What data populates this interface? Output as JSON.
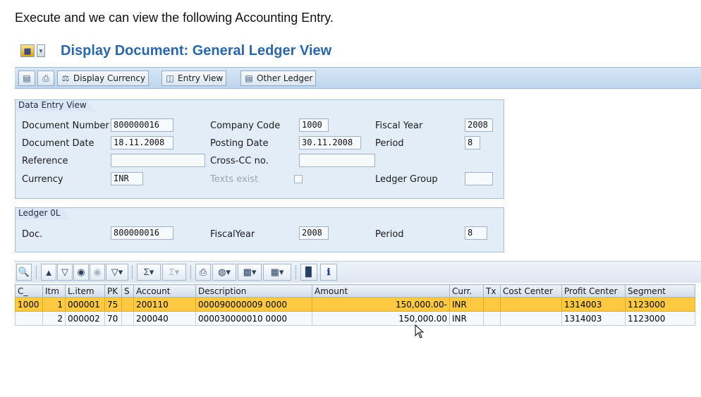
{
  "intro_text": "Execute and we can view the following Accounting Entry.",
  "window": {
    "title": "Display Document: General Ledger View"
  },
  "toolbar": {
    "display_currency": "Display Currency",
    "entry_view": "Entry View",
    "other_ledger": "Other Ledger"
  },
  "data_entry_view": {
    "group_title": "Data Entry View",
    "document_number_label": "Document Number",
    "document_number": "800000016",
    "company_code_label": "Company Code",
    "company_code": "1000",
    "fiscal_year_label": "Fiscal Year",
    "fiscal_year": "2008",
    "document_date_label": "Document Date",
    "document_date": "18.11.2008",
    "posting_date_label": "Posting Date",
    "posting_date": "30.11.2008",
    "period_label": "Period",
    "period": "8",
    "reference_label": "Reference",
    "reference": "",
    "cross_cc_label": "Cross-CC no.",
    "cross_cc": "",
    "currency_label": "Currency",
    "currency": "INR",
    "texts_exist_label": "Texts exist",
    "ledger_group_label": "Ledger Group",
    "ledger_group": ""
  },
  "ledger": {
    "group_title": "Ledger 0L",
    "doc_label": "Doc.",
    "doc": "800000016",
    "fiscal_year_label": "FiscalYear",
    "fiscal_year": "2008",
    "period_label": "Period",
    "period": "8"
  },
  "table": {
    "headers": [
      "C_",
      "Itm",
      "L.item",
      "PK",
      "S",
      "Account",
      "Description",
      "Amount",
      "Curr.",
      "Tx",
      "Cost Center",
      "Profit Center",
      "Segment"
    ],
    "rows": [
      [
        "1000",
        "1",
        "000001",
        "75",
        "",
        "200110",
        "000090000009 0000",
        "150,000.00-",
        "INR",
        "",
        "",
        "1314003",
        "1123000"
      ],
      [
        "",
        "2",
        "000002",
        "70",
        "",
        "200040",
        "000030000010 0000",
        "150,000.00",
        "INR",
        "",
        "",
        "1314003",
        "1123000"
      ]
    ]
  },
  "colors": {
    "title": "#2b67a6",
    "selected_row": "#fcc940",
    "toolbar": "#c9dcf0"
  }
}
